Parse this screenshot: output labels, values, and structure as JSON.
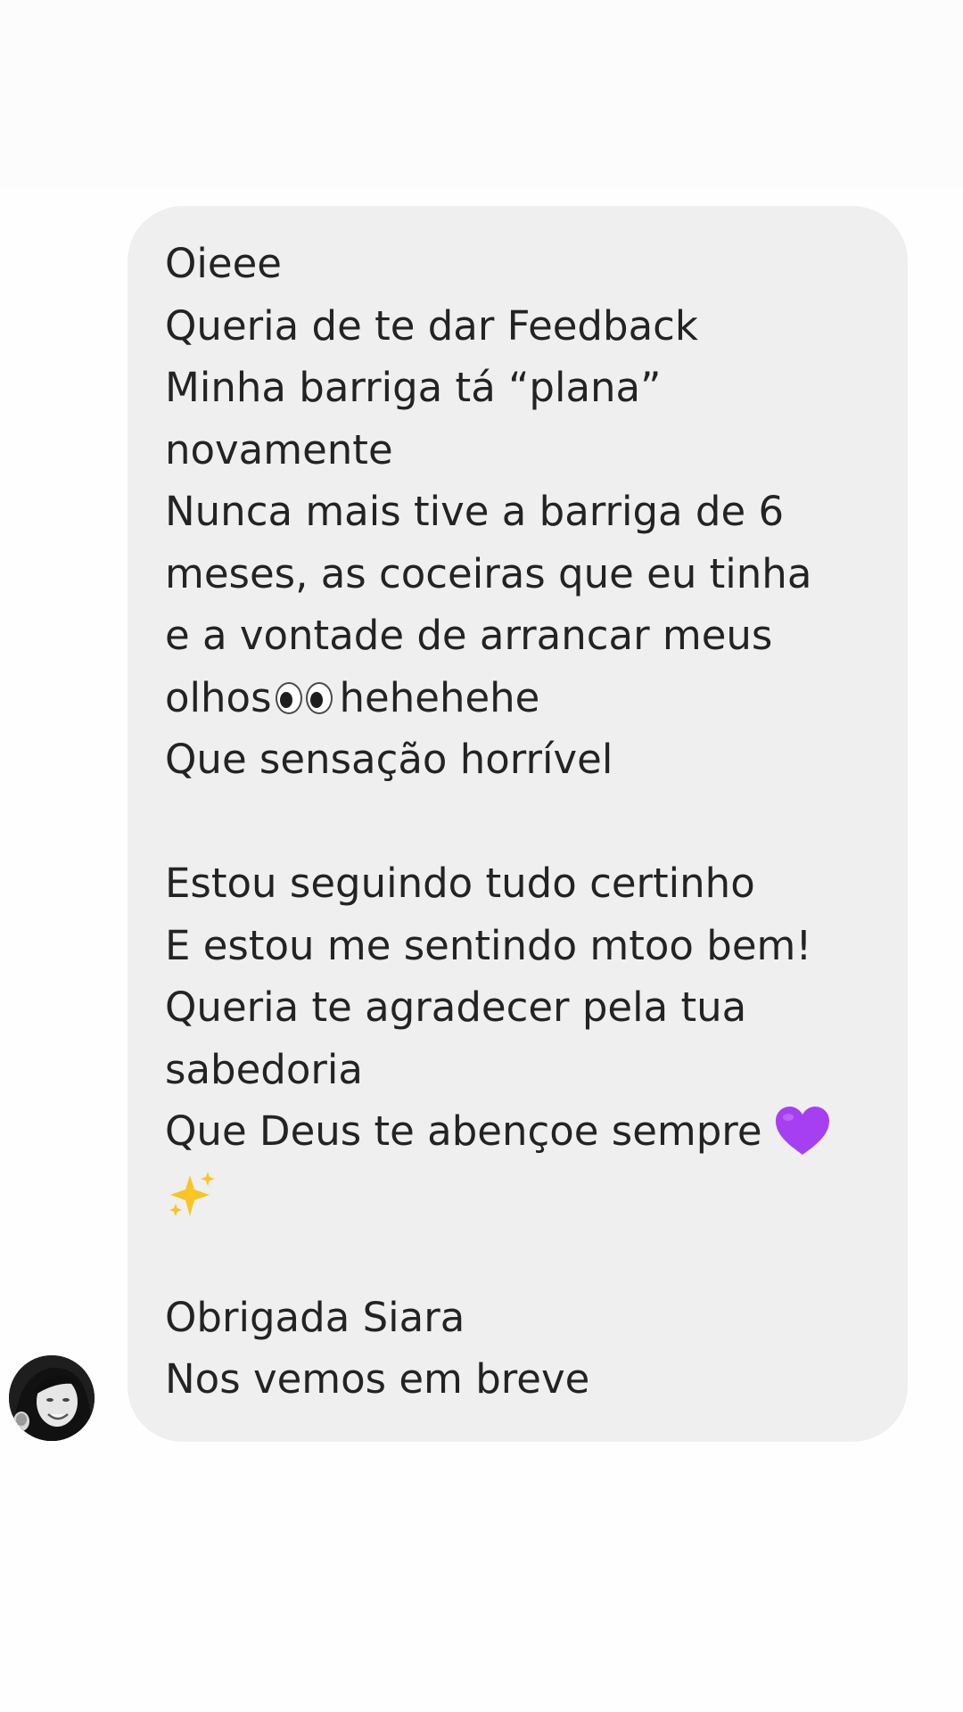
{
  "message": {
    "lines": [
      "Oieee",
      "Queria de te dar Feedback",
      "Minha barriga tá “plana”",
      "novamente",
      "Nunca mais tive a barriga de 6",
      "meses, as coceiras que eu tinha",
      "e a vontade de arrancar meus",
      "olhos",
      "hehehehe",
      "Que sensação horrível",
      "",
      "Estou seguindo tudo certinho",
      "E estou me sentindo mtoo bem!",
      "Queria te agradecer pela tua",
      "sabedoria",
      "Que Deus te abençoe sempre",
      "",
      "",
      "Obrigada Siara",
      "Nos vemos em breve"
    ],
    "emojis": {
      "eyes": "eyes-icon",
      "heart": "purple-heart-icon",
      "sparkles": "sparkles-icon"
    }
  },
  "colors": {
    "bubble": "#efefef",
    "text": "#232323",
    "heart": "#a63ff1",
    "sparkles": "#f7c624"
  },
  "sender": {
    "avatar": "avatar"
  }
}
